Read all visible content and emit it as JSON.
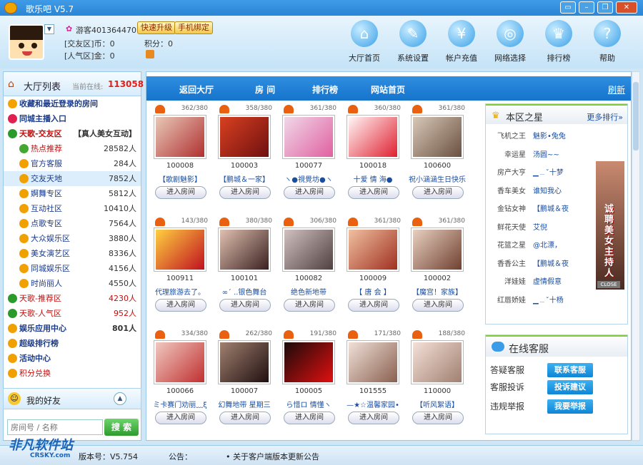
{
  "app": {
    "title": "歌乐吧 V5.7"
  },
  "user": {
    "name": "游客401364470 (7",
    "coins_label": "[交友区]币：0",
    "points_label": "积分：0",
    "popularity_label": "[人气区]金：0"
  },
  "buttons": {
    "upgrade": "快速升级",
    "bind": "手机绑定"
  },
  "nav": [
    {
      "label": "大厅首页",
      "icon": "home-icon",
      "glyph": "⌂"
    },
    {
      "label": "系统设置",
      "icon": "wrench-icon",
      "glyph": "✎"
    },
    {
      "label": "帐户充值",
      "icon": "moneybag-icon",
      "glyph": "¥"
    },
    {
      "label": "网络选择",
      "icon": "globe-icon",
      "glyph": "◎"
    },
    {
      "label": "排行榜",
      "icon": "crown-icon",
      "glyph": "♛"
    },
    {
      "label": "帮助",
      "icon": "help-icon",
      "glyph": "?"
    }
  ],
  "sidebar": {
    "title": "大厅列表",
    "online_label": "当前在线:",
    "online_count": "113058",
    "items": [
      {
        "label": "收藏和最近登录的房间",
        "count": "",
        "indent": 0,
        "bold": true,
        "color": "#1a3a8a",
        "icon": "star-icon",
        "ic": "#f4a200"
      },
      {
        "label": "同城主播入口",
        "count": "",
        "indent": 0,
        "bold": true,
        "color": "#1a3a8a",
        "icon": "heart-icon",
        "ic": "#e02050"
      },
      {
        "label": "天歌-交友区",
        "count": "【真人美女互动】",
        "indent": 0,
        "bold": true,
        "color": "#c01010",
        "icon": "person-icon",
        "ic": "#2a9a2a"
      },
      {
        "label": "热点推荐",
        "count": "28582人",
        "indent": 1,
        "bold": false,
        "color": "#c01010",
        "icon": "hot-icon",
        "ic": "#44a830"
      },
      {
        "label": "官方客服",
        "count": "284人",
        "indent": 1,
        "bold": false,
        "color": "#1a3a8a",
        "icon": "group-icon",
        "ic": "#f0a000"
      },
      {
        "label": "交友天地",
        "count": "7852人",
        "indent": 1,
        "bold": false,
        "color": "#1a3a8a",
        "icon": "group-icon",
        "ic": "#f0a000"
      },
      {
        "label": "婀舞专区",
        "count": "5812人",
        "indent": 1,
        "bold": false,
        "color": "#1a3a8a",
        "icon": "group-icon",
        "ic": "#f0a000"
      },
      {
        "label": "互动社区",
        "count": "10410人",
        "indent": 1,
        "bold": false,
        "color": "#1a3a8a",
        "icon": "group-icon",
        "ic": "#f0a000"
      },
      {
        "label": "点歌专区",
        "count": "7564人",
        "indent": 1,
        "bold": false,
        "color": "#1a3a8a",
        "icon": "group-icon",
        "ic": "#f0a000"
      },
      {
        "label": "大众娱乐区",
        "count": "3880人",
        "indent": 1,
        "bold": false,
        "color": "#1a3a8a",
        "icon": "group-icon",
        "ic": "#f0a000"
      },
      {
        "label": "美女演艺区",
        "count": "8336人",
        "indent": 1,
        "bold": false,
        "color": "#1a3a8a",
        "icon": "group-icon",
        "ic": "#f0a000"
      },
      {
        "label": "同城娱乐区",
        "count": "4156人",
        "indent": 1,
        "bold": false,
        "color": "#1a3a8a",
        "icon": "group-icon",
        "ic": "#f0a000"
      },
      {
        "label": "时尚丽人",
        "count": "4550人",
        "indent": 1,
        "bold": false,
        "color": "#1a3a8a",
        "icon": "group-icon",
        "ic": "#f0a000"
      },
      {
        "label": "天歌-推荐区",
        "count": "4230人",
        "indent": 0,
        "bold": false,
        "color": "#c01010",
        "icon": "person-icon",
        "ic": "#2a9a2a"
      },
      {
        "label": "天歌-人气区",
        "count": "952人",
        "indent": 0,
        "bold": false,
        "color": "#c01010",
        "icon": "person-icon",
        "ic": "#2a9a2a"
      },
      {
        "label": "娱乐应用中心",
        "count": "801人",
        "indent": 0,
        "bold": true,
        "color": "#1a3a8a",
        "icon": "smile-icon",
        "ic": "#f0a000"
      },
      {
        "label": "超级排行榜",
        "count": "",
        "indent": 0,
        "bold": true,
        "color": "#1a3a8a",
        "icon": "smile-icon",
        "ic": "#f0a000"
      },
      {
        "label": "活动中心",
        "count": "",
        "indent": 0,
        "bold": true,
        "color": "#1a3a8a",
        "icon": "smile-icon",
        "ic": "#f0a000"
      },
      {
        "label": "积分兑换",
        "count": "",
        "indent": 0,
        "bold": false,
        "color": "#c01010",
        "icon": "smile-icon",
        "ic": "#f0a000"
      }
    ]
  },
  "friends": {
    "title": "我的好友"
  },
  "search": {
    "placeholder": "房间号 / 名称",
    "button": "搜 索"
  },
  "tabs": [
    {
      "label": "返回大厅"
    },
    {
      "label": "房  间"
    },
    {
      "label": "排行榜"
    },
    {
      "label": "网站首页"
    }
  ],
  "refresh": "刷新",
  "rooms": [
    {
      "count": "362/380",
      "id": "100008",
      "name": "【歌剧魅影】",
      "c1": "#e8c8b8",
      "c2": "#b03030"
    },
    {
      "count": "358/380",
      "id": "100003",
      "name": "【鹏城＆一家】",
      "c1": "#d84020",
      "c2": "#701010"
    },
    {
      "count": "361/380",
      "id": "100077",
      "name": "ヽ●視覺坊●ヽ",
      "c1": "#f0d8e8",
      "c2": "#e060a0"
    },
    {
      "count": "360/380",
      "id": "100018",
      "name": "十爱  情  海●",
      "c1": "#fff6f6",
      "c2": "#e02030"
    },
    {
      "count": "361/380",
      "id": "100600",
      "name": "祝小涵涵生日快乐",
      "c1": "#d8c8b8",
      "c2": "#6a5040"
    },
    {
      "count": "143/380",
      "id": "100911",
      "name": "代理旅游去了。",
      "c1": "#ffd040",
      "c2": "#c01020"
    },
    {
      "count": "380/380",
      "id": "100101",
      "name": "∞´ ..银色舞台",
      "c1": "#e0c0b0",
      "c2": "#3a2020"
    },
    {
      "count": "306/380",
      "id": "100082",
      "name": "绝色新地带",
      "c1": "#d0c0c0",
      "c2": "#504040"
    },
    {
      "count": "361/380",
      "id": "100009",
      "name": "【 唐  会 】",
      "c1": "#f0c0a0",
      "c2": "#a03020"
    },
    {
      "count": "361/380",
      "id": "100002",
      "name": "【魔宫！家族】",
      "c1": "#e8d0c0",
      "c2": "#704030"
    },
    {
      "count": "334/380",
      "id": "100066",
      "name": "ミ卡赛门劝丽﹏ξ",
      "c1": "#f0c8c0",
      "c2": "#c03030"
    },
    {
      "count": "262/380",
      "id": "100007",
      "name": "幻舞地带  星期三",
      "c1": "#a08070",
      "c2": "#201010"
    },
    {
      "count": "191/380",
      "id": "100005",
      "name": "ら惜ロ  情懂ヽ",
      "c1": "#1a0a0a",
      "c2": "#e01010"
    },
    {
      "count": "171/380",
      "id": "101555",
      "name": "—★☆温馨家园•",
      "c1": "#f0e0d8",
      "c2": "#8a6050"
    },
    {
      "count": "188/380",
      "id": "110000",
      "name": "【听风絮语】",
      "c1": "#f4e0d8",
      "c2": "#a08070"
    }
  ],
  "enter_label": "进入房间",
  "stars": {
    "title": "本区之星",
    "more": "更多排行»",
    "rows": [
      {
        "k": "飞机之王",
        "v": "魅影•兔兔"
      },
      {
        "k": "幸运星",
        "v": "汤圆~~"
      },
      {
        "k": "房产大亨",
        "v": "▁﹍ˇ十梦"
      },
      {
        "k": "香车美女",
        "v": "谁知我心"
      },
      {
        "k": "金钻女神",
        "v": "【鹏城＆夜"
      },
      {
        "k": "鲜花天使",
        "v": "艾倪"
      },
      {
        "k": "花篮之星",
        "v": "@北漂，"
      },
      {
        "k": "香香公主",
        "v": "【鹏城＆夜"
      },
      {
        "k": "洋娃娃",
        "v": "虚情假意"
      },
      {
        "k": "红唇娇娃",
        "v": "▁﹍ˇ十杨"
      }
    ],
    "ad_text": "诚聘美女主持人",
    "ad_close": "CLOSE"
  },
  "cs": {
    "title": "在线客服",
    "rows": [
      {
        "k": "答疑客服",
        "b": "联系客服"
      },
      {
        "k": "客服投诉",
        "b": "投诉建议"
      },
      {
        "k": "违规举报",
        "b": "我要举报"
      }
    ]
  },
  "status": {
    "version_label": "版本号：V5.754",
    "notice_label": "公告：",
    "notice": "• 关于客户端版本更新公告"
  },
  "watermark": {
    "site": "非凡软件站",
    "sub": "CRSKY.com"
  }
}
